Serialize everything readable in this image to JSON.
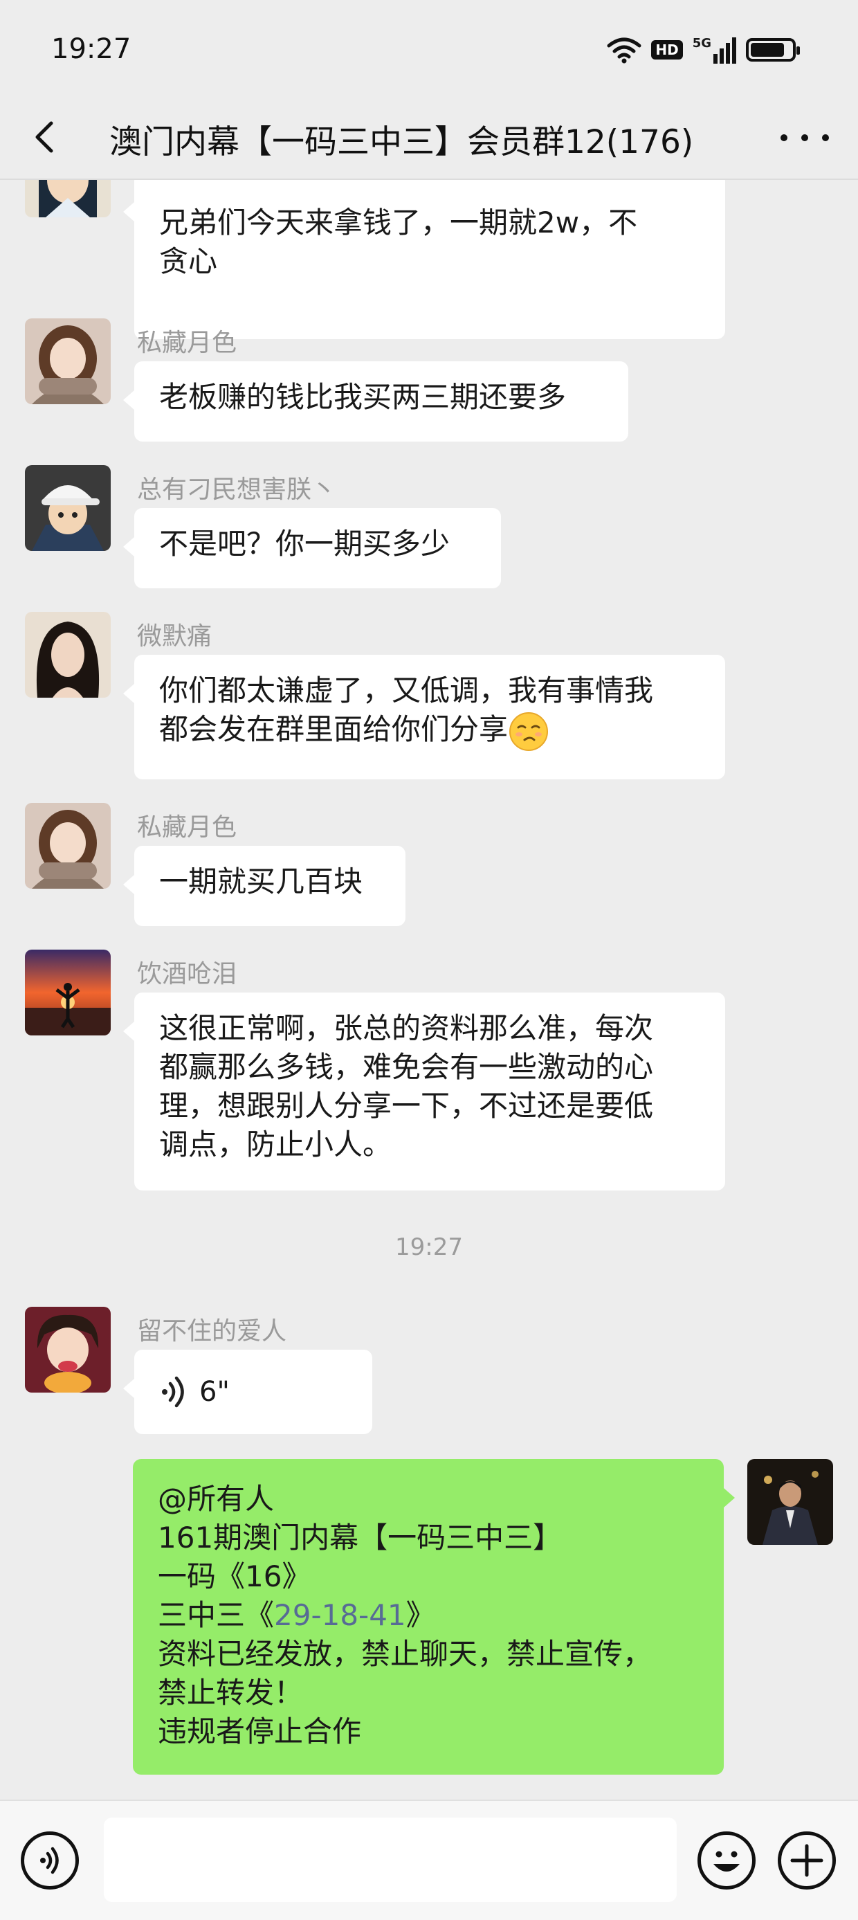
{
  "status_bar": {
    "time": "19:27",
    "hd_label": "HD",
    "network_label": "5G",
    "battery_level": 0.82,
    "icons": [
      "wifi-icon",
      "hd-icon",
      "5g-signal-icon",
      "battery-icon"
    ]
  },
  "header": {
    "back_icon": "chevron-left-icon",
    "title": "澳门内幕【一码三中三】会员群12(176)",
    "more_icon": "more-dots-icon"
  },
  "messages": [
    {
      "sender": "",
      "lines": [
        "兄弟们今天来拿钱了，一期就2w，不",
        "贪心"
      ]
    },
    {
      "sender": "私藏月色",
      "lines": [
        "老板赚的钱比我买两三期还要多"
      ]
    },
    {
      "sender": "总有刁民想害朕丶",
      "lines": [
        "不是吧？你一期买多少"
      ]
    },
    {
      "sender": "微默痛",
      "lines": [
        "你们都太谦虚了，又低调，我有事情我",
        "都会发在群里面给你们分享"
      ]
    },
    {
      "sender": "私藏月色",
      "lines": [
        "一期就买几百块"
      ]
    },
    {
      "sender": "饮酒呛泪",
      "lines": [
        "这很正常啊，张总的资料那么准，每次",
        "都赢那么多钱，难免会有一些激动的心",
        "理，想跟别人分享一下，不过还是要低",
        "调点，防止小人。"
      ]
    },
    {
      "sender": "留不住的爱人",
      "voice_duration": "6\""
    },
    {
      "sender": "",
      "mine": true,
      "lines": [
        "@所有人",
        "161期澳门内幕【一码三中三】",
        "一码《16》",
        "资料已经发放，禁止聊天，禁止宣传，",
        "禁止转发！",
        "违规者停止合作"
      ],
      "line4_prefix": "三中三《",
      "line4_link": "29-18-41",
      "line4_suffix": "》"
    }
  ],
  "timestamp": "19:27",
  "bottom_bar": {
    "voice_icon": "voice-input-icon",
    "emoji_icon": "emoji-icon",
    "plus_icon": "plus-icon"
  },
  "colors": {
    "background": "#ededed",
    "my_bubble": "#95ec69",
    "link": "#576b95"
  }
}
